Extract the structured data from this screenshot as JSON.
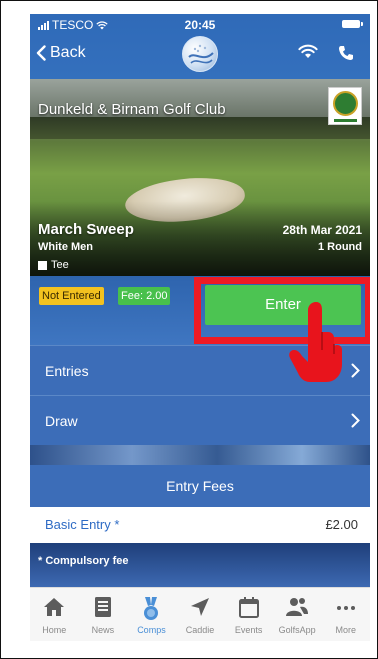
{
  "status_bar": {
    "carrier": "TESCO",
    "time": "20:45"
  },
  "nav": {
    "back_label": "Back"
  },
  "club": {
    "name": "Dunkeld & Birnam Golf Club"
  },
  "competition": {
    "name": "March Sweep",
    "date": "28th Mar 2021",
    "tee_group": "White Men",
    "rounds": "1 Round",
    "tee_label": "Tee"
  },
  "entry": {
    "status": "Not Entered",
    "fee_badge": "Fee: 2.00",
    "enter_button": "Enter"
  },
  "menu": [
    {
      "label": "Entries"
    },
    {
      "label": "Draw"
    }
  ],
  "fees": {
    "header": "Entry Fees",
    "items": [
      {
        "name": "Basic Entry *",
        "amount": "£2.00"
      }
    ],
    "note": "* Compulsory fee"
  },
  "tabs": [
    {
      "label": "Home",
      "icon": "home-icon"
    },
    {
      "label": "News",
      "icon": "news-icon"
    },
    {
      "label": "Comps",
      "icon": "medal-icon",
      "active": true
    },
    {
      "label": "Caddie",
      "icon": "caddie-arrow-icon"
    },
    {
      "label": "Events",
      "icon": "calendar-icon"
    },
    {
      "label": "GolfsApp",
      "icon": "users-icon"
    },
    {
      "label": "More",
      "icon": "more-icon"
    }
  ],
  "colors": {
    "primary": "#3c6db8",
    "enter_green": "#4cc452",
    "not_entered_yellow": "#f3c21f",
    "highlight_red": "#ee1b24",
    "active_tab": "#4a8fd6"
  }
}
